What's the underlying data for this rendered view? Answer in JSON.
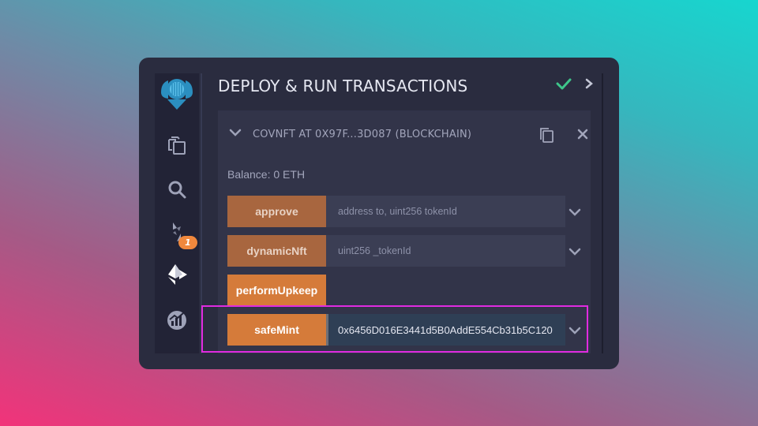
{
  "header": {
    "title": "DEPLOY & RUN TRANSACTIONS",
    "status_icon": "check-icon",
    "expand_icon": "chevron-right-icon"
  },
  "sidebar": {
    "logo": "remix-logo-icon",
    "items": [
      {
        "icon": "file-explorer-icon",
        "badge": ""
      },
      {
        "icon": "search-icon",
        "badge": ""
      },
      {
        "icon": "solidity-compiler-icon",
        "badge": "1"
      },
      {
        "icon": "deploy-run-icon",
        "badge": ""
      },
      {
        "icon": "analytics-icon",
        "badge": ""
      }
    ]
  },
  "contract": {
    "title": "COVNFT AT 0X97F...3D087 (BLOCKCHAIN)",
    "balance": "Balance: 0 ETH",
    "functions": [
      {
        "label": "approve",
        "placeholder": "address to, uint256 tokenId",
        "value": ""
      },
      {
        "label": "dynamicNft",
        "placeholder": "uint256 _tokenId",
        "value": ""
      },
      {
        "label": "performUpkeep",
        "placeholder": "",
        "value": ""
      },
      {
        "label": "safeMint",
        "placeholder": "",
        "value": "0x6456D016E3441d5B0AddE554Cb31b5C120"
      }
    ]
  },
  "colors": {
    "accent_orange": "#d57b3a",
    "dim_orange": "#a8663f",
    "highlight_magenta": "#e02be0",
    "success_green": "#3ec68a",
    "panel_bg": "#2a2c3f"
  }
}
